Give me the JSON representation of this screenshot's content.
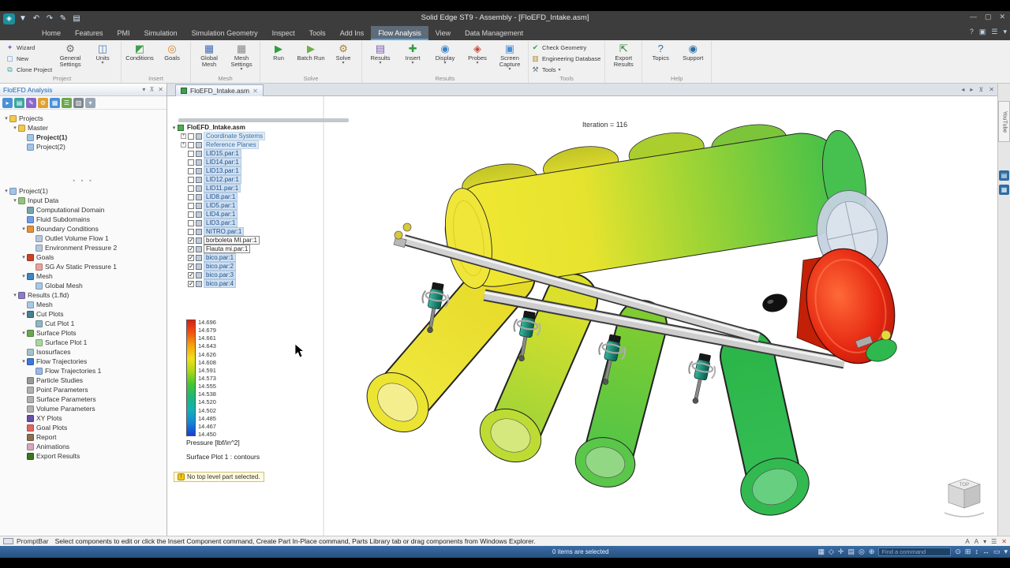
{
  "titlebar": {
    "title": "Solid Edge ST9 - Assembly - [FloEFD_Intake.asm]",
    "quick_access": [
      "save-icon",
      "undo-icon",
      "redo-icon",
      "style-icon",
      "window-icon"
    ],
    "window_buttons": [
      "minimize",
      "maximize",
      "close"
    ]
  },
  "ribbon": {
    "tabs": [
      "Home",
      "Features",
      "PMI",
      "Simulation",
      "Simulation Geometry",
      "Inspect",
      "Tools",
      "Add Ins",
      "Flow Analysis",
      "View",
      "Data Management"
    ],
    "active_tab": "Flow Analysis",
    "right_icons": [
      "help-icon",
      "panel-icon",
      "menu-icon",
      "collapse-icon"
    ],
    "groups": [
      {
        "label": "Project",
        "buttons": [
          {
            "l": "Wizard",
            "i": "wizard",
            "s": 1
          },
          {
            "l": "New",
            "i": "new",
            "s": 1
          },
          {
            "l": "Clone Project",
            "i": "clone",
            "s": 1
          },
          {
            "l": "General Settings",
            "i": "settings"
          },
          {
            "l": "Units",
            "i": "units",
            "a": 1
          }
        ]
      },
      {
        "label": "Insert",
        "buttons": [
          {
            "l": "Conditions",
            "i": "conditions"
          },
          {
            "l": "Goals",
            "i": "goals"
          }
        ]
      },
      {
        "label": "Mesh",
        "buttons": [
          {
            "l": "Global Mesh",
            "i": "mesh"
          },
          {
            "l": "Mesh Settings",
            "i": "meshset",
            "a": 1
          }
        ]
      },
      {
        "label": "Solve",
        "buttons": [
          {
            "l": "Run",
            "i": "run"
          },
          {
            "l": "Batch Run",
            "i": "batch"
          },
          {
            "l": "Solve",
            "i": "solve",
            "a": 1
          }
        ]
      },
      {
        "label": "Results",
        "buttons": [
          {
            "l": "Results",
            "i": "results",
            "a": 1
          },
          {
            "l": "Insert",
            "i": "insert",
            "a": 1
          },
          {
            "l": "Display",
            "i": "display",
            "a": 1
          },
          {
            "l": "Probes",
            "i": "probes",
            "a": 1
          },
          {
            "l": "Screen Capture",
            "i": "capture",
            "a": 1
          }
        ]
      },
      {
        "label": "Tools",
        "buttons": [
          {
            "l": "Check Geometry",
            "i": "checkgeo",
            "s": 1
          },
          {
            "l": "Engineering Database",
            "i": "engdb",
            "s": 1
          },
          {
            "l": "Tools",
            "i": "tools",
            "s": 1,
            "a": 1
          }
        ]
      },
      {
        "label": "",
        "buttons": [
          {
            "l": "Export Results",
            "i": "export"
          }
        ]
      },
      {
        "label": "Help",
        "buttons": [
          {
            "l": "Topics",
            "i": "topics"
          },
          {
            "l": "Support",
            "i": "support"
          }
        ]
      }
    ]
  },
  "left_panel": {
    "title": "FloEFD Analysis",
    "tree": [
      {
        "lv": 0,
        "t": "Projects",
        "i": "folder",
        "ar": 1
      },
      {
        "lv": 1,
        "t": "Master",
        "i": "folder",
        "ar": 1
      },
      {
        "lv": 2,
        "t": "Project(1)",
        "i": "doc",
        "b": 1
      },
      {
        "lv": 2,
        "t": "Project(2)",
        "i": "doc"
      },
      {
        "sep": 1
      },
      {
        "lv": 0,
        "t": "Project(1)",
        "i": "doc",
        "ar": 1
      },
      {
        "lv": 1,
        "t": "Input Data",
        "i": "input",
        "ar": 1
      },
      {
        "lv": 2,
        "t": "Computational Domain",
        "i": "domain"
      },
      {
        "lv": 2,
        "t": "Fluid Subdomains",
        "i": "fluid"
      },
      {
        "lv": 2,
        "t": "Boundary Conditions",
        "i": "bc",
        "ar": 1
      },
      {
        "lv": 3,
        "t": "Outlet Volume Flow 1",
        "i": "leaf"
      },
      {
        "lv": 3,
        "t": "Environment Pressure 2",
        "i": "leaf"
      },
      {
        "lv": 2,
        "t": "Goals",
        "i": "goal",
        "ar": 1
      },
      {
        "lv": 3,
        "t": "SG Av Static Pressure 1",
        "i": "goalleaf"
      },
      {
        "lv": 2,
        "t": "Mesh",
        "i": "mesh",
        "ar": 1
      },
      {
        "lv": 3,
        "t": "Global Mesh",
        "i": "meshleaf"
      },
      {
        "lv": 1,
        "t": "Results (1.fld)",
        "i": "results",
        "ar": 1
      },
      {
        "lv": 2,
        "t": "Mesh",
        "i": "meshleaf"
      },
      {
        "lv": 2,
        "t": "Cut Plots",
        "i": "cut",
        "ar": 1
      },
      {
        "lv": 3,
        "t": "Cut Plot 1",
        "i": "cutleaf"
      },
      {
        "lv": 2,
        "t": "Surface Plots",
        "i": "surf",
        "ar": 1
      },
      {
        "lv": 3,
        "t": "Surface Plot 1",
        "i": "surfleaf"
      },
      {
        "lv": 2,
        "t": "Isosurfaces",
        "i": "iso"
      },
      {
        "lv": 2,
        "t": "Flow Trajectories",
        "i": "traj",
        "ar": 1
      },
      {
        "lv": 3,
        "t": "Flow Trajectories 1",
        "i": "trajleaf"
      },
      {
        "lv": 2,
        "t": "Particle Studies",
        "i": "part"
      },
      {
        "lv": 2,
        "t": "Point Parameters",
        "i": "param"
      },
      {
        "lv": 2,
        "t": "Surface Parameters",
        "i": "param"
      },
      {
        "lv": 2,
        "t": "Volume Parameters",
        "i": "param"
      },
      {
        "lv": 2,
        "t": "XY Plots",
        "i": "xy"
      },
      {
        "lv": 2,
        "t": "Goal Plots",
        "i": "goalplot"
      },
      {
        "lv": 2,
        "t": "Report",
        "i": "report"
      },
      {
        "lv": 2,
        "t": "Animations",
        "i": "anim"
      },
      {
        "lv": 2,
        "t": "Export Results",
        "i": "export"
      }
    ]
  },
  "doc_tab": {
    "label": "FloEFD_Intake.asm"
  },
  "viewport": {
    "iteration_label": "Iteration = 116",
    "tree_root": "FloEFD_Intake.asm",
    "tree_items": [
      {
        "t": "Coordinate Systems",
        "cb": "off",
        "style": "sys",
        "plus": 1
      },
      {
        "t": "Reference Planes",
        "cb": "off",
        "style": "sys",
        "plus": 1
      },
      {
        "t": "LID15.par:1",
        "cb": "off",
        "style": "hl"
      },
      {
        "t": "LID14.par:1",
        "cb": "off",
        "style": "hl"
      },
      {
        "t": "LID13.par:1",
        "cb": "off",
        "style": "hl"
      },
      {
        "t": "LID12.par:1",
        "cb": "off",
        "style": "hl"
      },
      {
        "t": "LID11.par:1",
        "cb": "off",
        "style": "hl"
      },
      {
        "t": "LID8.par:1",
        "cb": "off",
        "style": "hl"
      },
      {
        "t": "LID5.par:1",
        "cb": "off",
        "style": "hl"
      },
      {
        "t": "LID4.par:1",
        "cb": "off",
        "style": "hl"
      },
      {
        "t": "LID3.par:1",
        "cb": "off",
        "style": "hl"
      },
      {
        "t": "NITRO.par:1",
        "cb": "off",
        "style": "hl"
      },
      {
        "t": "borboleta MI.par:1",
        "cb": "on",
        "style": "box"
      },
      {
        "t": "Flauta mi.par:1",
        "cb": "on",
        "style": "box"
      },
      {
        "t": "bico.par:1",
        "cb": "on",
        "style": "hl"
      },
      {
        "t": "bico.par:2",
        "cb": "on",
        "style": "hl"
      },
      {
        "t": "bico.par:3",
        "cb": "on",
        "style": "hl"
      },
      {
        "t": "bico.par:4",
        "cb": "on",
        "style": "hl"
      }
    ],
    "legend": {
      "values": [
        "14.696",
        "14.679",
        "14.661",
        "14.643",
        "14.626",
        "14.608",
        "14.591",
        "14.573",
        "14.555",
        "14.538",
        "14.520",
        "14.502",
        "14.485",
        "14.467",
        "14.450"
      ],
      "gradient": [
        "#e01b14",
        "#f0560f",
        "#f5a60d",
        "#f2e01a",
        "#a8d816",
        "#46c432",
        "#1cb878",
        "#12b2b8",
        "#1286d8",
        "#1c3ed0"
      ],
      "title": "Pressure [lbf/in^2]",
      "subtitle": "Surface Plot 1 : contours"
    },
    "warning": "No top level part selected.",
    "viewcube_label": "TOP"
  },
  "side_tab": {
    "label": "YouTube"
  },
  "prompt_bar": {
    "label": "PromptBar",
    "text": "Select components to edit or click the Insert Component command, Create Part In-Place command, Parts Library tab or drag components from Windows Explorer.",
    "right_icons": [
      "A",
      "A",
      "▾",
      "☰",
      "✕"
    ]
  },
  "status_bar": {
    "selection": "0 items are selected",
    "search_placeholder": "Find a command",
    "icons_left": [
      "▦",
      "◇",
      "✛",
      "▤",
      "◎",
      "⊕"
    ],
    "icons_right": [
      "⊙",
      "⊞",
      "↕",
      "↔",
      "▭",
      "▾"
    ]
  }
}
